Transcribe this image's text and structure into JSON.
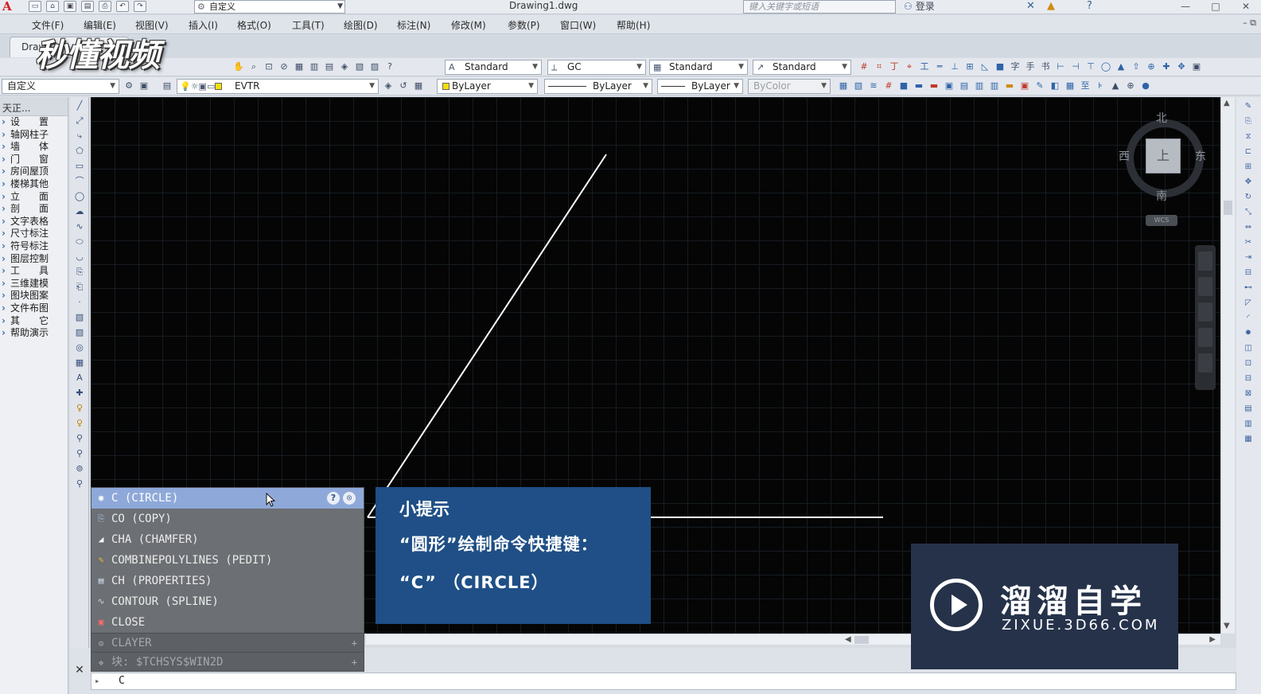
{
  "titlebar": {
    "app_logo": "A",
    "workspace": "自定义",
    "title": "Drawing1.dwg",
    "search_placeholder": "键入关键字或短语",
    "login": "登录",
    "help_icon": "?"
  },
  "menu": [
    "文件(F)",
    "编辑(E)",
    "视图(V)",
    "插入(I)",
    "格式(O)",
    "工具(T)",
    "绘图(D)",
    "标注(N)",
    "修改(M)",
    "参数(P)",
    "窗口(W)",
    "帮助(H)"
  ],
  "file_tab": "Draw",
  "video_watermark": "秒懂视频",
  "toolbar1": {
    "text_style": "Standard",
    "dim_style": "GC",
    "table_style": "Standard",
    "mleader_style": "Standard"
  },
  "toolbar2": {
    "workspace": "自定义",
    "layer": "EVTR",
    "color": "ByLayer",
    "linetype": "ByLayer",
    "lineweight": "ByLayer",
    "plotstyle": "ByColor"
  },
  "palette": {
    "title": "天正...",
    "items": [
      "设　　置",
      "轴网柱子",
      "墙　　体",
      "门　　窗",
      "房间屋顶",
      "楼梯其他",
      "立　　面",
      "剖　　面",
      "文字表格",
      "尺寸标注",
      "符号标注",
      "图层控制",
      "工　　具",
      "三维建模",
      "图块图案",
      "文件布图",
      "其　　它",
      "帮助演示"
    ]
  },
  "viewcube": {
    "north": "北",
    "south": "南",
    "east": "东",
    "west": "西",
    "face": "上",
    "wcs": "WCS"
  },
  "autocomplete": {
    "items": [
      {
        "label": "C (CIRCLE)",
        "icon": "circle-icon"
      },
      {
        "label": "CO (COPY)",
        "icon": "copy-icon"
      },
      {
        "label": "CHA (CHAMFER)",
        "icon": "chamfer-icon"
      },
      {
        "label": "COMBINEPOLYLINES (PEDIT)",
        "icon": "pedit-icon"
      },
      {
        "label": "CH (PROPERTIES)",
        "icon": "properties-icon"
      },
      {
        "label": "CONTOUR (SPLINE)",
        "icon": "spline-icon"
      },
      {
        "label": "CLOSE",
        "icon": "close-doc-icon"
      }
    ],
    "sections": [
      "CLAYER",
      "块: $TCHSYS$WIN2D"
    ]
  },
  "tip": {
    "title": "小提示",
    "line1": "“圆形”绘制命令快捷键：",
    "line2": "“C” （CIRCLE）"
  },
  "brand": {
    "name": "溜溜自学",
    "url": "ZIXUE.3D66.COM"
  },
  "command": {
    "prompt_icon": "▸",
    "value": "C"
  },
  "colors": {
    "canvas": "#050505",
    "tip_bg": "#1f4f86",
    "brand_bg": "#25324a",
    "selection": "#8ea9d9"
  }
}
